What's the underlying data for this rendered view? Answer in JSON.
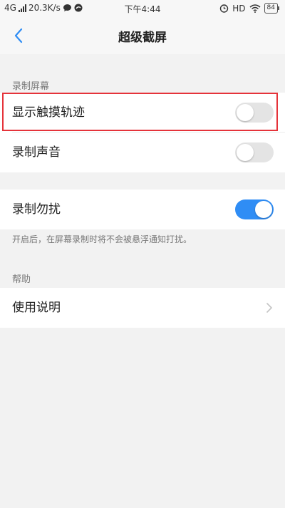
{
  "status_bar": {
    "network": "4G",
    "speed": "20.3K/s",
    "time": "下午4:44",
    "hd": "HD",
    "battery": "84"
  },
  "header": {
    "title": "超级截屏"
  },
  "sections": {
    "recording_screen": "录制屏幕",
    "help": "帮助"
  },
  "settings": {
    "show_touch_track": {
      "label": "显示触摸轨迹",
      "enabled": false
    },
    "record_sound": {
      "label": "录制声音",
      "enabled": false
    },
    "do_not_disturb": {
      "label": "录制勿扰",
      "enabled": true,
      "description": "开启后，在屏幕录制时将不会被悬浮通知打扰。"
    },
    "instructions": {
      "label": "使用说明"
    }
  },
  "colors": {
    "accent": "#2f8df5",
    "highlight": "#e5333a",
    "background": "#f2f2f2"
  }
}
